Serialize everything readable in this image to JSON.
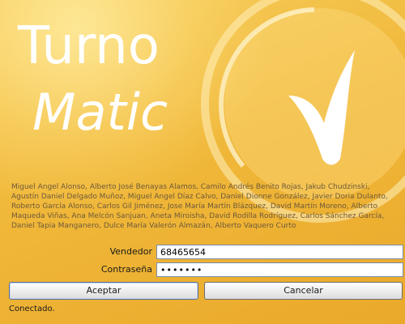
{
  "app": {
    "title_line1": "Turno",
    "title_line2": "Matic"
  },
  "credits": "Miguel Angel Alonso, Alberto José Benayas Alamos, Camilo Andrés Benito Rojas, Jakub Chudzinski, Agustín Daniel Delgado Muñoz, Miguel Angel Díaz Calvo, Daniel Dionne González, Javier Doria Dulanto, Roberto García Alonso, Carlos Gil Jiménez, Jose María Martín Blázquez, David Martín Moreno, Alberto Maqueda Viñas, Ana Melcón Sanjuan, Aneta Miroisha, David Rodilla Rodríguez, Carlos Sánchez García, Daniel Tapia Manganero, Dulce María Valerón Almazán, Alberto Vaquero Curto",
  "form": {
    "vendedor_label": "Vendedor",
    "vendedor_value": "68465654",
    "password_label": "Contraseña",
    "password_value": "•••••••"
  },
  "buttons": {
    "accept_label": "Aceptar",
    "cancel_label": "Cancelar"
  },
  "status": "Conectado.",
  "colors": {
    "background": "#f2bd3e",
    "logo_white": "#ffffff",
    "credits_text": "#6e5a3a"
  },
  "icons": {
    "logo": "clock-checkmark-logo-icon"
  }
}
